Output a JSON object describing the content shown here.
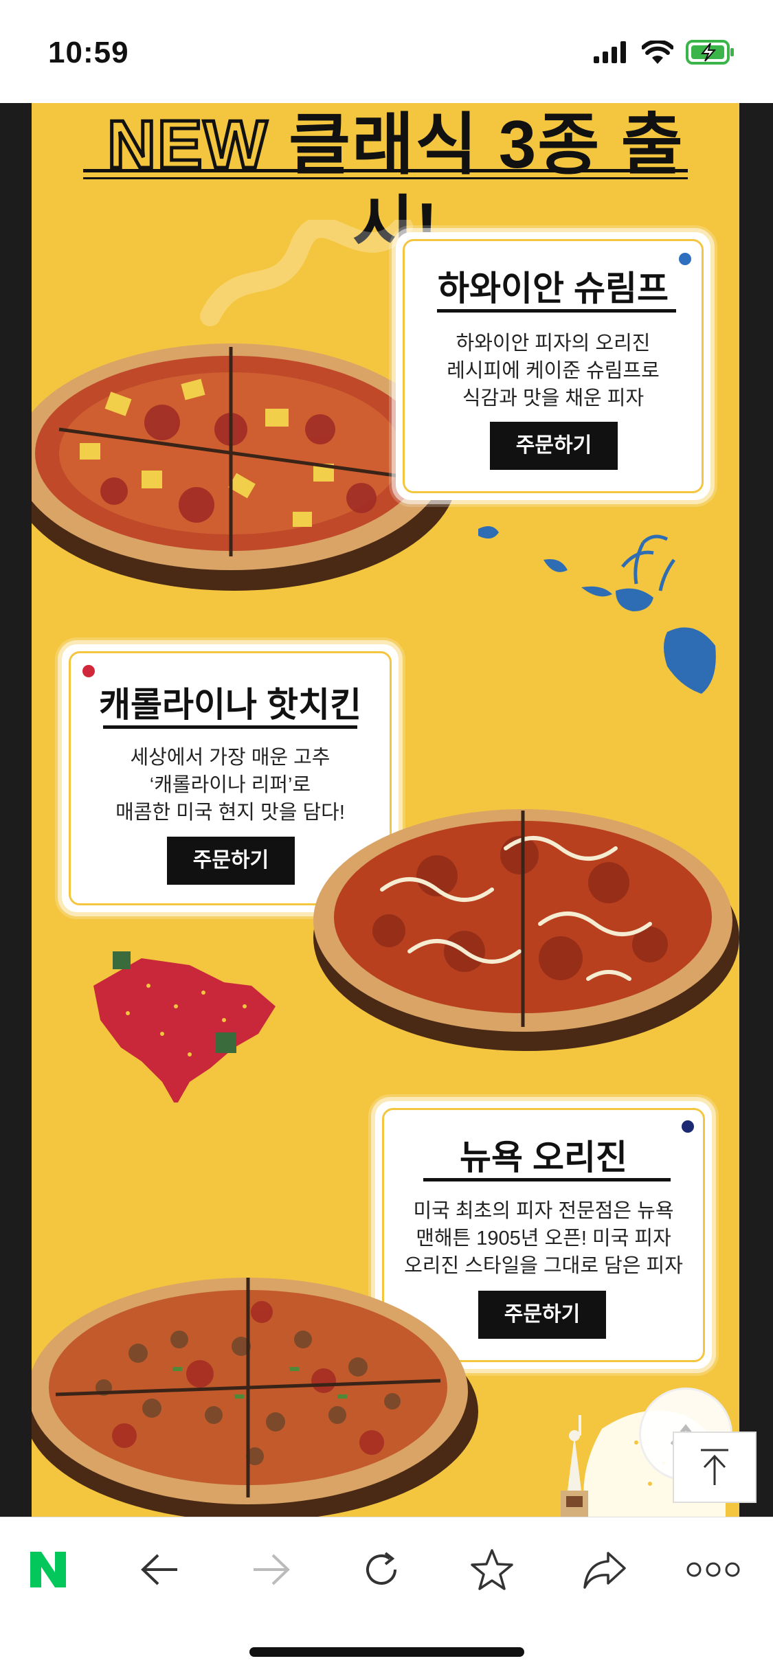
{
  "status": {
    "time": "10:59"
  },
  "headline": {
    "prefix": "NEW",
    "rest": " 클래식 3종 출시!"
  },
  "products": [
    {
      "name": "하와이안 슈림프",
      "desc": [
        "하와이안 피자의 오리진",
        "레시피에 케이준 슈림프로",
        "식감과 맛을 채운 피자"
      ],
      "order": "주문하기",
      "dot_color": "#2f6fc0"
    },
    {
      "name": "캐롤라이나 핫치킨",
      "desc": [
        "세상에서 가장 매운 고추",
        "‘캐롤라이나 리퍼’로",
        "매콤한 미국 현지 맛을 담다!"
      ],
      "order": "주문하기",
      "dot_color": "#d0283a"
    },
    {
      "name": "뉴욕 오리진",
      "desc": [
        "미국 최초의 피자 전문점은 뉴욕",
        "맨해튼 1905년 오픈! 미국 피자",
        "오리진 스타일을 그대로 담은 피자"
      ],
      "order": "주문하기",
      "dot_color": "#1b2a72"
    }
  ],
  "colors": {
    "panel": "#f4c63f",
    "naver_green": "#03c75a",
    "hawaii_blue": "#2e6db4",
    "carolina_red": "#c9283a"
  },
  "bottom_nav": [
    {
      "icon": "naver-logo-icon",
      "label": "N"
    },
    {
      "icon": "back-arrow-icon"
    },
    {
      "icon": "forward-arrow-icon"
    },
    {
      "icon": "refresh-icon"
    },
    {
      "icon": "star-icon"
    },
    {
      "icon": "share-icon"
    },
    {
      "icon": "more-icon"
    }
  ]
}
